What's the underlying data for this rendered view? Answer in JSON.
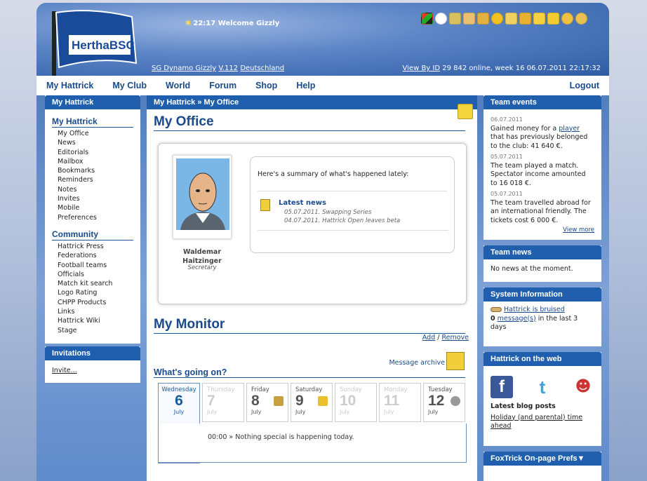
{
  "header": {
    "welcome": "22:17 Welcome Gizzly",
    "team_name": "SG Dynamo Gizzly",
    "version": "V.112",
    "country": "Deutschland",
    "view_by_id": "View By ID",
    "online": "29 842 online, week 16",
    "datetime": "06.07.2011 22:17:32",
    "logo_text": "HerthaBSC",
    "tool_icons": [
      "flag-icon",
      "clock-icon",
      "cup-icon",
      "trainer-icon",
      "whistle-icon",
      "ball-icon",
      "newspaper-icon",
      "sync-icon",
      "note-icon",
      "doc-icon",
      "medal-icon",
      "search-icon"
    ]
  },
  "nav": {
    "items": [
      "My Hattrick",
      "My Club",
      "World",
      "Forum",
      "Shop",
      "Help"
    ],
    "logout": "Logout"
  },
  "left": {
    "title": "My Hattrick",
    "section1": "My Hattrick",
    "items1": [
      "My Office",
      "News",
      "Editorials",
      "Mailbox",
      "Bookmarks",
      "Reminders",
      "Notes",
      "Invites",
      "Mobile",
      "Preferences"
    ],
    "section2": "Community",
    "items2": [
      "Hattrick Press",
      "Federations",
      "Football teams",
      "Officials",
      "Match kit search",
      "Logo Rating",
      "CHPP Products",
      "Links",
      "Hattrick Wiki",
      "Stage"
    ],
    "invitations_title": "Invitations",
    "invite_link": "Invite..."
  },
  "main": {
    "crumb1": "My Hattrick",
    "crumb_sep": "»",
    "crumb2": "My Office",
    "title": "My Office",
    "summary": "Here's a summary of what's happened lately:",
    "latest_news": "Latest news",
    "news": [
      "05.07.2011. Swapping Series",
      "04.07.2011. Hattrick Open leaves beta"
    ],
    "staff_name_1": "Waldemar",
    "staff_name_2": "Haitzinger",
    "staff_role": "Secretary",
    "monitor_title": "My Monitor",
    "add": "Add",
    "slash": "/",
    "remove": "Remove",
    "message_archive": "Message archive",
    "whats_going_on": "What's going on?",
    "schedule_text": "00:00 » Nothing special is happening today.",
    "days": [
      {
        "name": "Wednesday",
        "num": "6",
        "month": "July",
        "state": "today"
      },
      {
        "name": "Thursday",
        "num": "7",
        "month": "July",
        "state": "dim"
      },
      {
        "name": "Friday",
        "num": "8",
        "month": "July",
        "state": "normal",
        "icon": "training-icon"
      },
      {
        "name": "Saturday",
        "num": "9",
        "month": "July",
        "state": "normal",
        "icon": "match-icon"
      },
      {
        "name": "Sunday",
        "num": "10",
        "month": "July",
        "state": "dim"
      },
      {
        "name": "Monday",
        "num": "11",
        "month": "July",
        "state": "dim"
      },
      {
        "name": "Tuesday",
        "num": "12",
        "month": "July",
        "state": "normal",
        "icon": "cup-icon"
      }
    ]
  },
  "right": {
    "team_events_title": "Team events",
    "events": [
      {
        "date": "06.07.2011",
        "pre": "Gained money for a ",
        "link": "player",
        "post": " that has previously belonged to the club: 41 640 €."
      },
      {
        "date": "05.07.2011",
        "pre": "The team played a match. Spectator income amounted to 16 018 €.",
        "link": "",
        "post": ""
      },
      {
        "date": "05.07.2011",
        "pre": "The team travelled abroad for an international friendly. The tickets cost 6 000 €.",
        "link": "",
        "post": ""
      }
    ],
    "view_more": "View more",
    "team_news_title": "Team news",
    "team_news_text": "No news at the moment.",
    "system_title": "System Information",
    "system_link": "Hattrick is bruised",
    "messages_pre": "0",
    "messages_link": "message(s)",
    "messages_post": " in the last 3 days",
    "web_title": "Hattrick on the web",
    "blog_title": "Latest blog posts",
    "blog_link": "Holiday (and parental) time ahead",
    "fox_title": "FoxTrick On-page Prefs▼"
  }
}
